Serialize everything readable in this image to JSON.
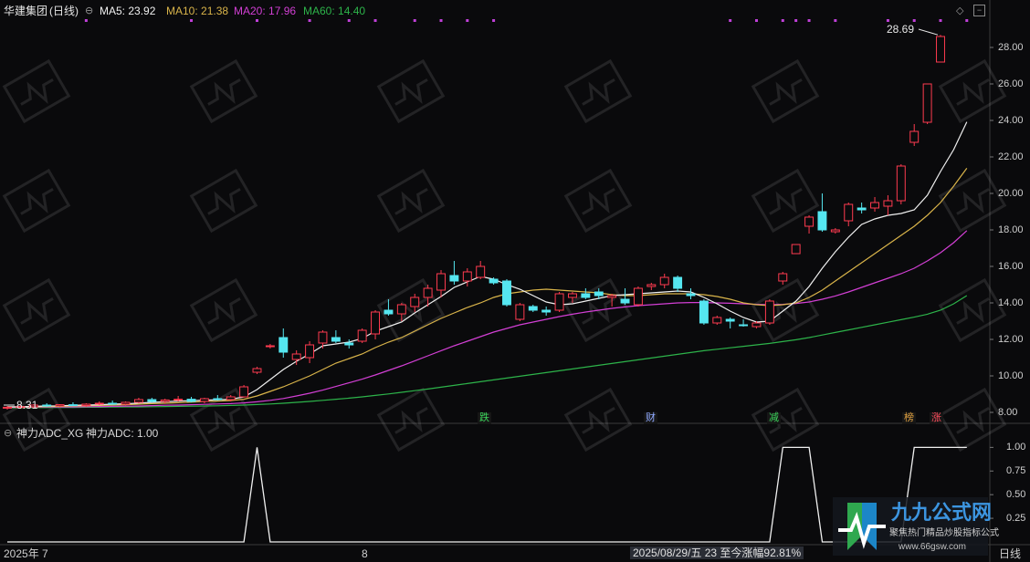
{
  "header": {
    "stock_name": "华建集团",
    "period_tag": "(日线)",
    "ma5": "MA5: 23.92",
    "ma10": "MA10: 21.38",
    "ma20": "MA20: 17.96",
    "ma60": "MA60: 14.40"
  },
  "indicator_header": {
    "name": "神力ADC_XG",
    "value": "神力ADC: 1.00"
  },
  "annotations": {
    "max_label": "28.69",
    "min_label": "8.31",
    "bottom_status": "2025/08/29/五 23 至今涨幅92.81%",
    "period_button": "日线",
    "tags": [
      {
        "text": "跌",
        "color": "#3ad45a"
      },
      {
        "text": "财",
        "color": "#8fa8ff"
      },
      {
        "text": "减",
        "color": "#3ad45a"
      },
      {
        "text": "榜",
        "color": "#e0a040"
      },
      {
        "text": "涨",
        "color": "#ff4b5c"
      }
    ]
  },
  "watermark": {
    "brand": "九九公式网",
    "slogan": "聚焦热门精品炒股指标公式",
    "url": "www.66gsw.com"
  },
  "colors": {
    "up": "#ff3b4f",
    "down": "#55e6f0",
    "ma5": "#f0f0f0",
    "ma10": "#d9b44a",
    "ma20": "#d23fd4",
    "ma60": "#2db34a",
    "indicator": "#f0f0f0"
  },
  "chart_data": [
    {
      "type": "candlestick",
      "title": "华建集团(日线)",
      "x_labels": [
        "2025年 7",
        "8"
      ],
      "ylim": [
        7.6,
        29.6
      ],
      "yticks": [
        "8.00",
        "10.00",
        "12.00",
        "14.00",
        "16.00",
        "18.00",
        "20.00",
        "22.00",
        "24.00",
        "26.00",
        "28.00"
      ],
      "candles": [
        {
          "o": 8.25,
          "h": 8.35,
          "l": 8.15,
          "c": 8.28
        },
        {
          "o": 8.28,
          "h": 8.38,
          "l": 8.2,
          "c": 8.31
        },
        {
          "o": 8.31,
          "h": 8.45,
          "l": 8.25,
          "c": 8.4
        },
        {
          "o": 8.4,
          "h": 8.5,
          "l": 8.3,
          "c": 8.35
        },
        {
          "o": 8.35,
          "h": 8.45,
          "l": 8.28,
          "c": 8.42
        },
        {
          "o": 8.42,
          "h": 8.55,
          "l": 8.35,
          "c": 8.38
        },
        {
          "o": 8.38,
          "h": 8.5,
          "l": 8.3,
          "c": 8.45
        },
        {
          "o": 8.45,
          "h": 8.6,
          "l": 8.4,
          "c": 8.5
        },
        {
          "o": 8.5,
          "h": 8.65,
          "l": 8.42,
          "c": 8.45
        },
        {
          "o": 8.45,
          "h": 8.6,
          "l": 8.38,
          "c": 8.55
        },
        {
          "o": 8.55,
          "h": 8.8,
          "l": 8.5,
          "c": 8.7
        },
        {
          "o": 8.7,
          "h": 8.8,
          "l": 8.55,
          "c": 8.6
        },
        {
          "o": 8.6,
          "h": 8.75,
          "l": 8.5,
          "c": 8.68
        },
        {
          "o": 8.68,
          "h": 8.9,
          "l": 8.6,
          "c": 8.72
        },
        {
          "o": 8.72,
          "h": 8.85,
          "l": 8.55,
          "c": 8.6
        },
        {
          "o": 8.6,
          "h": 8.8,
          "l": 8.5,
          "c": 8.75
        },
        {
          "o": 8.75,
          "h": 8.95,
          "l": 8.65,
          "c": 8.7
        },
        {
          "o": 8.7,
          "h": 8.95,
          "l": 8.6,
          "c": 8.85
        },
        {
          "o": 8.85,
          "h": 9.5,
          "l": 8.8,
          "c": 9.4
        },
        {
          "o": 10.2,
          "h": 10.5,
          "l": 10.1,
          "c": 10.4
        },
        {
          "o": 11.6,
          "h": 11.75,
          "l": 11.5,
          "c": 11.65
        },
        {
          "o": 12.1,
          "h": 12.6,
          "l": 11.0,
          "c": 11.3
        },
        {
          "o": 10.9,
          "h": 11.4,
          "l": 10.6,
          "c": 11.2
        },
        {
          "o": 11.0,
          "h": 11.9,
          "l": 10.7,
          "c": 11.7
        },
        {
          "o": 11.8,
          "h": 12.5,
          "l": 11.5,
          "c": 12.4
        },
        {
          "o": 12.1,
          "h": 12.5,
          "l": 11.8,
          "c": 11.9
        },
        {
          "o": 11.8,
          "h": 12.0,
          "l": 11.5,
          "c": 11.7
        },
        {
          "o": 11.9,
          "h": 12.6,
          "l": 11.8,
          "c": 12.5
        },
        {
          "o": 12.3,
          "h": 13.6,
          "l": 12.0,
          "c": 13.5
        },
        {
          "o": 13.6,
          "h": 14.2,
          "l": 13.3,
          "c": 13.4
        },
        {
          "o": 13.4,
          "h": 14.0,
          "l": 13.0,
          "c": 13.9
        },
        {
          "o": 13.8,
          "h": 14.5,
          "l": 13.5,
          "c": 14.3
        },
        {
          "o": 14.3,
          "h": 15.0,
          "l": 13.8,
          "c": 14.8
        },
        {
          "o": 14.7,
          "h": 15.8,
          "l": 14.3,
          "c": 15.6
        },
        {
          "o": 15.5,
          "h": 16.3,
          "l": 15.0,
          "c": 15.2
        },
        {
          "o": 15.2,
          "h": 15.9,
          "l": 14.9,
          "c": 15.7
        },
        {
          "o": 15.4,
          "h": 16.3,
          "l": 15.3,
          "c": 16.0
        },
        {
          "o": 15.3,
          "h": 15.4,
          "l": 15.0,
          "c": 15.1
        },
        {
          "o": 15.2,
          "h": 15.3,
          "l": 13.8,
          "c": 13.9
        },
        {
          "o": 13.1,
          "h": 14.0,
          "l": 13.0,
          "c": 13.9
        },
        {
          "o": 13.8,
          "h": 13.9,
          "l": 13.5,
          "c": 13.6
        },
        {
          "o": 13.6,
          "h": 13.8,
          "l": 13.3,
          "c": 13.5
        },
        {
          "o": 13.6,
          "h": 14.6,
          "l": 13.5,
          "c": 14.5
        },
        {
          "o": 14.3,
          "h": 14.6,
          "l": 14.0,
          "c": 14.5
        },
        {
          "o": 14.5,
          "h": 14.8,
          "l": 14.2,
          "c": 14.3
        },
        {
          "o": 14.6,
          "h": 14.8,
          "l": 14.2,
          "c": 14.4
        },
        {
          "o": 14.3,
          "h": 14.5,
          "l": 13.8,
          "c": 14.4
        },
        {
          "o": 14.2,
          "h": 14.8,
          "l": 13.9,
          "c": 14.0
        },
        {
          "o": 13.9,
          "h": 14.9,
          "l": 13.8,
          "c": 14.8
        },
        {
          "o": 14.9,
          "h": 15.1,
          "l": 14.7,
          "c": 15.0
        },
        {
          "o": 15.0,
          "h": 15.6,
          "l": 14.8,
          "c": 15.4
        },
        {
          "o": 15.4,
          "h": 15.5,
          "l": 14.6,
          "c": 14.8
        },
        {
          "o": 14.5,
          "h": 14.8,
          "l": 14.2,
          "c": 14.4
        },
        {
          "o": 14.1,
          "h": 14.2,
          "l": 12.8,
          "c": 12.9
        },
        {
          "o": 12.9,
          "h": 13.3,
          "l": 12.8,
          "c": 13.2
        },
        {
          "o": 13.1,
          "h": 13.2,
          "l": 12.6,
          "c": 13.0
        },
        {
          "o": 12.8,
          "h": 13.1,
          "l": 12.7,
          "c": 12.75
        },
        {
          "o": 12.7,
          "h": 13.0,
          "l": 12.6,
          "c": 12.9
        },
        {
          "o": 12.9,
          "h": 14.2,
          "l": 12.8,
          "c": 14.1
        },
        {
          "o": 15.2,
          "h": 15.7,
          "l": 15.0,
          "c": 15.6
        },
        {
          "o": 16.7,
          "h": 17.2,
          "l": 16.7,
          "c": 17.2
        },
        {
          "o": 18.2,
          "h": 18.8,
          "l": 17.8,
          "c": 18.7
        },
        {
          "o": 19.0,
          "h": 20.0,
          "l": 17.9,
          "c": 18.0
        },
        {
          "o": 17.9,
          "h": 18.1,
          "l": 17.8,
          "c": 18.0
        },
        {
          "o": 18.5,
          "h": 19.5,
          "l": 18.2,
          "c": 19.4
        },
        {
          "o": 19.2,
          "h": 19.5,
          "l": 18.9,
          "c": 19.1
        },
        {
          "o": 19.2,
          "h": 19.8,
          "l": 19.0,
          "c": 19.5
        },
        {
          "o": 19.3,
          "h": 19.9,
          "l": 18.8,
          "c": 19.6
        },
        {
          "o": 19.6,
          "h": 21.6,
          "l": 19.4,
          "c": 21.5
        },
        {
          "o": 22.8,
          "h": 23.8,
          "l": 22.6,
          "c": 23.4
        },
        {
          "o": 23.9,
          "h": 26.0,
          "l": 23.8,
          "c": 26.0
        },
        {
          "o": 27.2,
          "h": 28.69,
          "l": 27.2,
          "c": 28.6
        }
      ],
      "ma5": [
        8.3,
        8.31,
        8.33,
        8.35,
        8.36,
        8.39,
        8.4,
        8.42,
        8.45,
        8.47,
        8.51,
        8.55,
        8.58,
        8.62,
        8.64,
        8.67,
        8.69,
        8.72,
        8.85,
        9.25,
        9.8,
        10.35,
        10.8,
        11.2,
        11.65,
        11.75,
        11.85,
        12.05,
        12.45,
        12.7,
        12.95,
        13.45,
        13.9,
        14.35,
        14.85,
        15.15,
        15.45,
        15.3,
        15.0,
        14.75,
        14.4,
        14.05,
        13.9,
        13.95,
        14.1,
        14.25,
        14.4,
        14.45,
        14.5,
        14.55,
        14.6,
        14.65,
        14.6,
        14.3,
        13.95,
        13.55,
        13.2,
        12.95,
        13.0,
        13.55,
        14.1,
        14.9,
        15.9,
        16.8,
        17.6,
        18.3,
        18.6,
        18.8,
        18.9,
        19.1,
        19.9,
        21.2,
        22.4,
        23.92
      ],
      "ma10": [
        8.3,
        8.3,
        8.31,
        8.32,
        8.33,
        8.35,
        8.36,
        8.38,
        8.4,
        8.42,
        8.45,
        8.48,
        8.5,
        8.53,
        8.56,
        8.6,
        8.62,
        8.65,
        8.72,
        8.9,
        9.15,
        9.4,
        9.7,
        10.0,
        10.35,
        10.7,
        10.95,
        11.2,
        11.55,
        11.85,
        12.1,
        12.45,
        12.8,
        13.15,
        13.45,
        13.75,
        14.0,
        14.3,
        14.5,
        14.6,
        14.7,
        14.75,
        14.7,
        14.65,
        14.6,
        14.55,
        14.45,
        14.4,
        14.4,
        14.45,
        14.5,
        14.5,
        14.5,
        14.45,
        14.35,
        14.2,
        14.0,
        13.9,
        13.85,
        13.9,
        14.0,
        14.3,
        14.7,
        15.2,
        15.7,
        16.2,
        16.7,
        17.2,
        17.7,
        18.2,
        18.8,
        19.5,
        20.4,
        21.38
      ],
      "ma20": [
        8.28,
        8.28,
        8.29,
        8.29,
        8.3,
        8.3,
        8.31,
        8.32,
        8.33,
        8.34,
        8.35,
        8.37,
        8.39,
        8.4,
        8.42,
        8.44,
        8.46,
        8.48,
        8.52,
        8.58,
        8.66,
        8.76,
        8.9,
        9.05,
        9.22,
        9.42,
        9.62,
        9.82,
        10.05,
        10.3,
        10.55,
        10.82,
        11.1,
        11.38,
        11.65,
        11.9,
        12.15,
        12.4,
        12.6,
        12.8,
        12.95,
        13.1,
        13.25,
        13.38,
        13.5,
        13.6,
        13.7,
        13.78,
        13.85,
        13.9,
        13.95,
        14.0,
        14.02,
        14.02,
        14.0,
        13.98,
        13.95,
        13.92,
        13.9,
        13.92,
        13.97,
        14.05,
        14.2,
        14.38,
        14.6,
        14.85,
        15.1,
        15.35,
        15.6,
        15.9,
        16.3,
        16.75,
        17.3,
        17.96
      ],
      "ma60": [
        8.25,
        8.25,
        8.26,
        8.26,
        8.27,
        8.27,
        8.28,
        8.28,
        8.29,
        8.3,
        8.3,
        8.31,
        8.32,
        8.33,
        8.34,
        8.35,
        8.36,
        8.38,
        8.4,
        8.43,
        8.46,
        8.5,
        8.55,
        8.6,
        8.66,
        8.72,
        8.78,
        8.85,
        8.93,
        9.01,
        9.1,
        9.19,
        9.28,
        9.38,
        9.48,
        9.58,
        9.68,
        9.78,
        9.88,
        9.98,
        10.08,
        10.18,
        10.28,
        10.38,
        10.48,
        10.58,
        10.68,
        10.78,
        10.88,
        10.98,
        11.08,
        11.18,
        11.28,
        11.38,
        11.46,
        11.54,
        11.62,
        11.7,
        11.78,
        11.88,
        11.98,
        12.1,
        12.24,
        12.38,
        12.52,
        12.66,
        12.8,
        12.94,
        13.08,
        13.22,
        13.38,
        13.6,
        13.95,
        14.4
      ]
    },
    {
      "type": "line",
      "title": "神力ADC_XG",
      "name": "神力ADC",
      "ylim": [
        0,
        1.1
      ],
      "yticks": [
        "1.00",
        "0.75",
        "0.50",
        "0.25"
      ],
      "values": [
        0,
        0,
        0,
        0,
        0,
        0,
        0,
        0,
        0,
        0,
        0,
        0,
        0,
        0,
        0,
        0,
        0,
        0,
        0,
        1,
        0,
        0,
        0,
        0,
        0,
        0,
        0,
        0,
        0,
        0,
        0,
        0,
        0,
        0,
        0,
        0,
        0,
        0,
        0,
        0,
        0,
        0,
        0,
        0,
        0,
        0,
        0,
        0,
        0,
        0,
        0,
        0,
        0,
        0,
        0,
        0,
        0,
        0,
        0,
        1,
        1,
        1,
        0,
        0,
        0,
        0,
        0,
        0,
        0,
        1,
        1,
        1,
        1,
        1
      ]
    }
  ]
}
